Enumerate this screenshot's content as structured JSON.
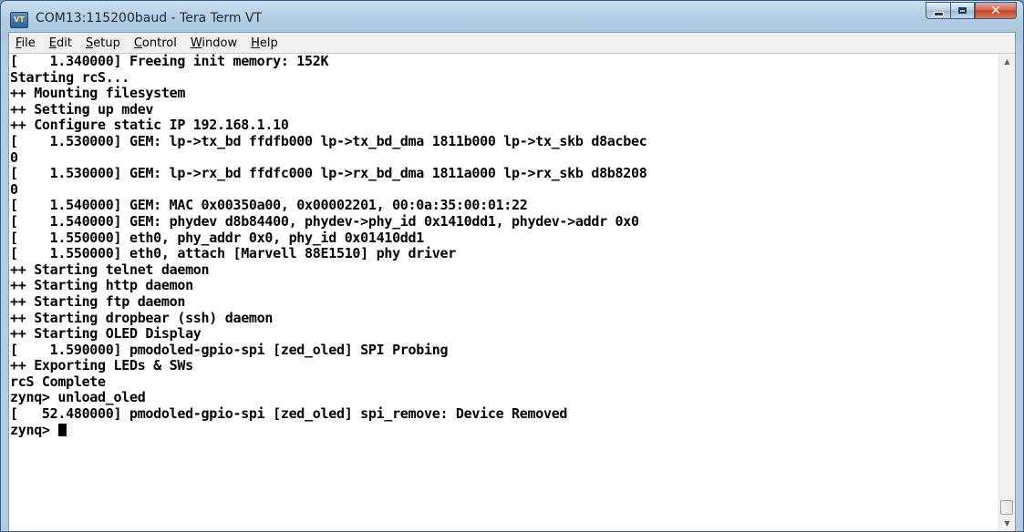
{
  "window": {
    "title": "COM13:115200baud - Tera Term VT",
    "icon_name": "tera-term-app-icon",
    "icon_glyph": "VT"
  },
  "caption_buttons": {
    "minimize_icon": "minimize-icon",
    "maximize_icon": "maximize-icon",
    "close_icon": "close-icon",
    "close_glyph": "✕"
  },
  "menu": {
    "items": [
      "File",
      "Edit",
      "Setup",
      "Control",
      "Window",
      "Help"
    ]
  },
  "terminal": {
    "lines": [
      "[    1.340000] Freeing init memory: 152K",
      "Starting rcS...",
      "++ Mounting filesystem",
      "++ Setting up mdev",
      "++ Configure static IP 192.168.1.10",
      "[    1.530000] GEM: lp->tx_bd ffdfb000 lp->tx_bd_dma 1811b000 lp->tx_skb d8acbec",
      "0",
      "[    1.530000] GEM: lp->rx_bd ffdfc000 lp->rx_bd_dma 1811a000 lp->rx_skb d8b8208",
      "0",
      "[    1.540000] GEM: MAC 0x00350a00, 0x00002201, 00:0a:35:00:01:22",
      "[    1.540000] GEM: phydev d8b84400, phydev->phy_id 0x1410dd1, phydev->addr 0x0",
      "[    1.550000] eth0, phy_addr 0x0, phy_id 0x01410dd1",
      "[    1.550000] eth0, attach [Marvell 88E1510] phy driver",
      "++ Starting telnet daemon",
      "++ Starting http daemon",
      "++ Starting ftp daemon",
      "++ Starting dropbear (ssh) daemon",
      "++ Starting OLED Display",
      "[    1.590000] pmodoled-gpio-spi [zed_oled] SPI Probing",
      "++ Exporting LEDs & SWs",
      "rcS Complete",
      "zynq> unload_oled",
      "[   52.480000] pmodoled-gpio-spi [zed_oled] spi_remove: Device Removed"
    ],
    "prompt": "zynq> "
  },
  "scrollbar": {
    "up_arrow": "▲",
    "down_arrow": "▼",
    "position_fraction": 1.0
  }
}
